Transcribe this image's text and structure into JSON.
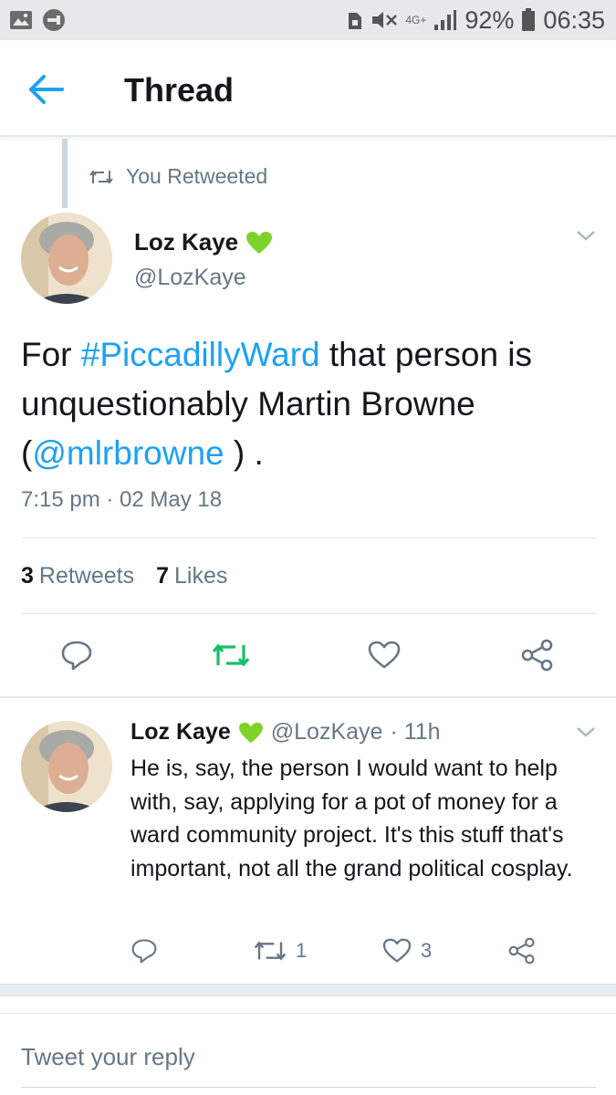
{
  "status_bar": {
    "network": "4G+",
    "battery": "92%",
    "time": "06:35"
  },
  "header": {
    "title": "Thread"
  },
  "retweet_context": {
    "label": "You Retweeted"
  },
  "main_tweet": {
    "author_name": "Loz Kaye",
    "author_handle": "@LozKaye",
    "text_parts": {
      "p1": "For ",
      "hashtag": "#PiccadillyWard",
      "p2": " that person is unquestionably Martin Browne (",
      "mention": "@mlrbrowne",
      "p3": " ) ."
    },
    "timestamp": "7:15 pm · 02 May 18",
    "retweets_count": "3",
    "retweets_label": "Retweets",
    "likes_count": "7",
    "likes_label": "Likes",
    "accent_color": "#1da1f2",
    "retweeted_color": "#17bf63"
  },
  "reply_tweet": {
    "author_name": "Loz Kaye",
    "author_handle": "@LozKaye",
    "time_ago": "· 11h",
    "text": "He is, say, the person I would want to help with, say, applying for a pot of money for a ward community project. It's this stuff that's important,  not all the grand political cosplay.",
    "retweet_count": "1",
    "like_count": "3"
  },
  "compose": {
    "placeholder": "Tweet your reply"
  }
}
